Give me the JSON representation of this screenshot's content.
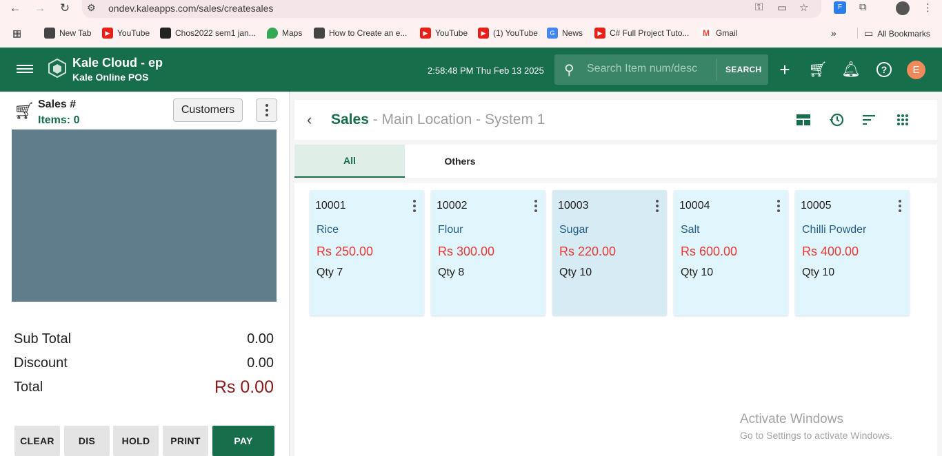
{
  "browser": {
    "url": "ondev.kaleapps.com/sales/createsales",
    "bookmarks": [
      {
        "label": "New Tab",
        "icon": "globe-icon"
      },
      {
        "label": "YouTube",
        "icon": "youtube-icon"
      },
      {
        "label": "Chos2022 sem1 jan...",
        "icon": "site-icon"
      },
      {
        "label": "Maps",
        "icon": "maps-icon"
      },
      {
        "label": "How to Create an e...",
        "icon": "globe-icon"
      },
      {
        "label": "YouTube",
        "icon": "youtube-icon"
      },
      {
        "label": "(1) YouTube",
        "icon": "youtube-icon"
      },
      {
        "label": "News",
        "icon": "news-icon"
      },
      {
        "label": "C# Full Project Tuto...",
        "icon": "youtube-icon"
      },
      {
        "label": "Gmail",
        "icon": "gmail-icon"
      }
    ],
    "all_bookmarks": "All Bookmarks"
  },
  "header": {
    "brand_title": "Kale Cloud - ep",
    "brand_subtitle": "Kale Online POS",
    "datetime": "2:58:48 PM Thu Feb 13 2025",
    "search_placeholder": "Search Item num/desc",
    "search_button": "SEARCH",
    "avatar_letter": "E"
  },
  "left": {
    "sales_label": "Sales #",
    "items_label": "Items: 0",
    "customers_button": "Customers",
    "subtotal_label": "Sub Total",
    "subtotal_value": "0.00",
    "discount_label": "Discount",
    "discount_value": "0.00",
    "total_label": "Total",
    "total_value": "Rs 0.00",
    "buttons": {
      "clear": "CLEAR",
      "dis": "DIS",
      "hold": "HOLD",
      "print": "PRINT",
      "pay": "PAY"
    }
  },
  "right": {
    "title_main": "Sales",
    "title_sub": " - Main Location - System 1",
    "tabs": [
      {
        "label": "All",
        "active": true
      },
      {
        "label": "Others",
        "active": false
      }
    ],
    "products": [
      {
        "code": "10001",
        "name": "Rice",
        "price": "Rs 250.00",
        "qty": "Qty 7"
      },
      {
        "code": "10002",
        "name": "Flour",
        "price": "Rs 300.00",
        "qty": "Qty 8"
      },
      {
        "code": "10003",
        "name": "Sugar",
        "price": "Rs 220.00",
        "qty": "Qty 10"
      },
      {
        "code": "10004",
        "name": "Salt",
        "price": "Rs 600.00",
        "qty": "Qty 10"
      },
      {
        "code": "10005",
        "name": "Chilli Powder",
        "price": "Rs 400.00",
        "qty": "Qty 10"
      }
    ]
  },
  "watermark": {
    "line1": "Activate Windows",
    "line2": "Go to Settings to activate Windows."
  },
  "colors": {
    "brand_green": "#176e4b",
    "price_red": "#e53935",
    "total_red": "#8b1a1a",
    "card_blue": "#e1f5fc",
    "cart_area": "#607d8b"
  }
}
